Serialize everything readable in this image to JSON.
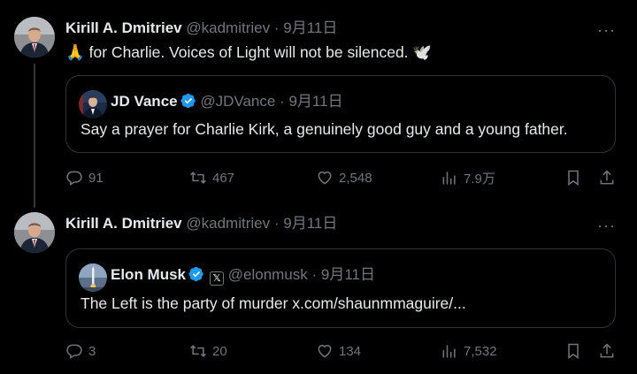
{
  "tweets": [
    {
      "author_name": "Kirill A. Dmitriev",
      "handle": "@kadmitriev",
      "separator": "·",
      "date": "9月11日",
      "more_label": "···",
      "text": "🙏 for Charlie.  Voices of Light will not be silenced. 🕊️",
      "quote": {
        "author_name": "JD Vance",
        "handle": "@JDVance",
        "separator": "·",
        "date": "9月11日",
        "text": "Say a prayer for Charlie Kirk, a genuinely good guy and a young father."
      },
      "actions": {
        "replies": "91",
        "reposts": "467",
        "likes": "2,548",
        "views": "7.9万"
      }
    },
    {
      "author_name": "Kirill A. Dmitriev",
      "handle": "@kadmitriev",
      "separator": "·",
      "date": "9月11日",
      "more_label": "···",
      "quote": {
        "author_name": "Elon Musk",
        "badge_label": "𝕏",
        "handle": "@elonmusk",
        "separator": "·",
        "date": "9月11日",
        "text": "The Left is the party of murder x.com/shaunmmaguire/..."
      },
      "actions": {
        "replies": "3",
        "reposts": "20",
        "likes": "134",
        "views": "7,532"
      }
    }
  ],
  "colors": {
    "background": "#000000",
    "text": "#e7e9ea",
    "muted": "#71767b",
    "border": "#2f3336",
    "verified": "#1d9bf0"
  }
}
